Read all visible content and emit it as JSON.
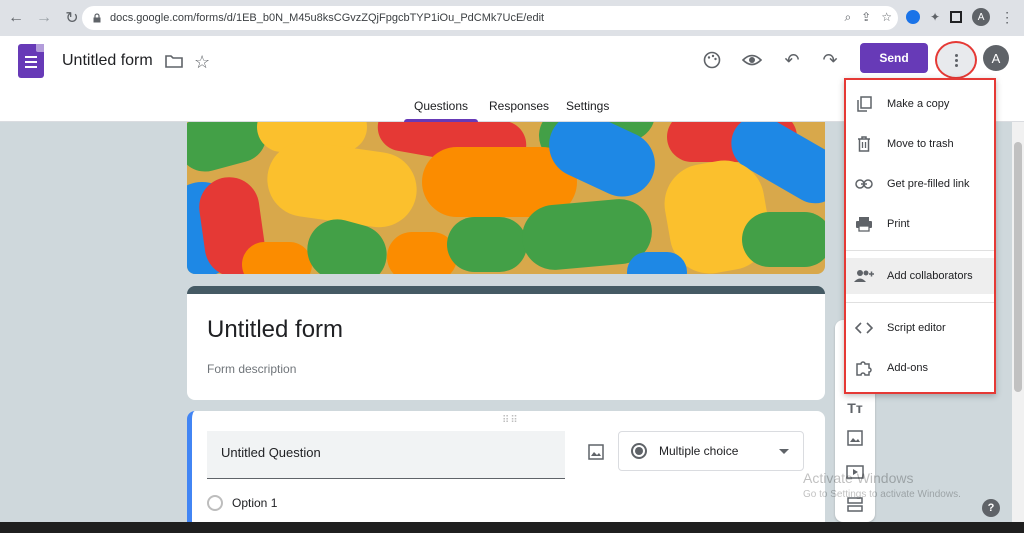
{
  "browser": {
    "url": "docs.google.com/forms/d/1EB_b0N_M45u8ksCGvzZQjFpgcbTYP1iOu_PdCMk7UcE/edit",
    "profile_initial": "A"
  },
  "header": {
    "doc_title": "Untitled form",
    "send_label": "Send",
    "account_initial": "A"
  },
  "tabs": [
    {
      "label": "Questions",
      "active": true
    },
    {
      "label": "Responses",
      "active": false
    },
    {
      "label": "Settings",
      "active": false
    }
  ],
  "form": {
    "title": "Untitled form",
    "description_placeholder": "Form description"
  },
  "question": {
    "title": "Untitled Question",
    "type": "Multiple choice",
    "options": [
      "Option 1"
    ]
  },
  "menu": {
    "items": [
      {
        "label": "Make a copy",
        "icon": "copy-icon"
      },
      {
        "label": "Move to trash",
        "icon": "trash-icon"
      },
      {
        "label": "Get pre-filled link",
        "icon": "link-icon"
      },
      {
        "label": "Print",
        "icon": "print-icon"
      },
      {
        "label": "Add collaborators",
        "icon": "add-people-icon"
      },
      {
        "label": "Script editor",
        "icon": "code-icon"
      },
      {
        "label": "Add-ons",
        "icon": "puzzle-icon"
      }
    ]
  },
  "watermark": {
    "title": "Activate Windows",
    "subtitle": "Go to Settings to activate Windows."
  },
  "colors": {
    "accent": "#673ab7",
    "highlight_border": "#e53935",
    "question_border": "#4285f4",
    "background": "#cfd8dc"
  }
}
